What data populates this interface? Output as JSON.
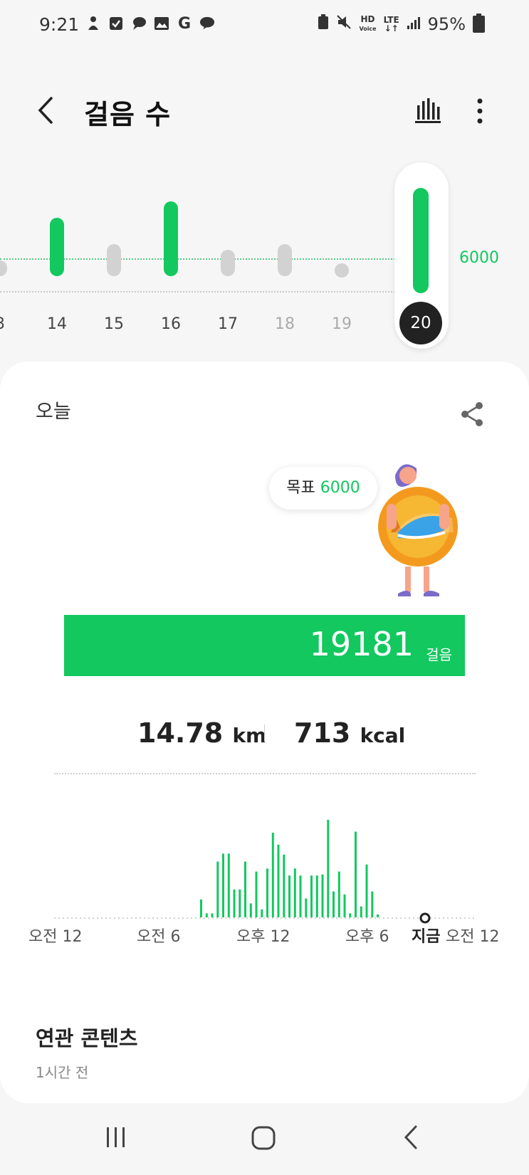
{
  "status_bar": {
    "time": "9:21",
    "hd_label": "HD",
    "voice_label": "Voice",
    "lte_label": "LTE",
    "battery": "95%",
    "left_icons": [
      "person-icon",
      "check-icon",
      "chat-icon",
      "image-icon",
      "g-icon",
      "talk-icon"
    ]
  },
  "header": {
    "title": "걸음 수"
  },
  "day_strip": {
    "goal_value": "6000",
    "days": [
      {
        "label": "3",
        "level": 0.15,
        "active": false,
        "faded": false
      },
      {
        "label": "14",
        "level": 0.55,
        "active": true,
        "faded": false
      },
      {
        "label": "15",
        "level": 0.3,
        "active": false,
        "faded": false
      },
      {
        "label": "16",
        "level": 0.7,
        "active": true,
        "faded": false
      },
      {
        "label": "17",
        "level": 0.25,
        "active": false,
        "faded": false
      },
      {
        "label": "18",
        "level": 0.3,
        "active": false,
        "faded": true
      },
      {
        "label": "19",
        "level": 0.0,
        "active": false,
        "faded": true
      }
    ],
    "selected_day": "20"
  },
  "today": {
    "label": "오늘",
    "goal_prefix": "목표",
    "goal_value": "6000",
    "steps": "19181",
    "steps_unit": "걸음",
    "distance": "14.78",
    "distance_unit": "km",
    "calories": "713",
    "calories_unit": "kcal"
  },
  "hourly_chart": {
    "x_labels": [
      "오전 12",
      "오전 6",
      "오후 12",
      "오후 6",
      "지금",
      "오전 12"
    ],
    "bars": [
      0.18,
      0.04,
      0.04,
      0.56,
      0.64,
      0.64,
      0.28,
      0.28,
      0.56,
      0.14,
      0.46,
      0.08,
      0.49,
      0.85,
      0.73,
      0.63,
      0.42,
      0.49,
      0.42,
      0.19,
      0.42,
      0.42,
      0.43,
      0.98,
      0.26,
      0.46,
      0.23,
      0.04,
      0.86,
      0.11,
      0.53,
      0.26,
      0.03
    ]
  },
  "related": {
    "title": "연관 콘텐츠",
    "time": "1시간 전"
  },
  "colors": {
    "accent": "#12c85f",
    "inactive": "#d2d2d2",
    "dark": "#222222"
  }
}
